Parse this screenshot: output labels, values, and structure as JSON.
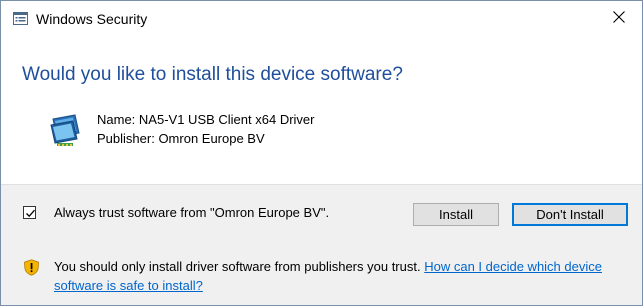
{
  "window": {
    "title": "Windows Security",
    "close_symbol": "✕"
  },
  "dialog": {
    "heading": "Would you like to install this device software?",
    "name_label": "Name:",
    "name_value": "NA5-V1 USB Client x64 Driver",
    "publisher_label": "Publisher:",
    "publisher_value": "Omron Europe BV",
    "icon": "network-adapter-icon"
  },
  "trust": {
    "checked": true,
    "label": "Always trust software from \"Omron Europe BV\"."
  },
  "buttons": {
    "install": "Install",
    "dont_install": "Don't Install"
  },
  "footer": {
    "warning_icon": "shield-warning-icon",
    "text": "You should only install driver software from publishers you trust.",
    "link": "How can I decide which device software is safe to install?"
  },
  "colors": {
    "heading": "#1f4e9c",
    "link": "#0066cc",
    "focus_border": "#0078d7",
    "panel_bg": "#f0f0f0",
    "warning": "#f4b400"
  }
}
